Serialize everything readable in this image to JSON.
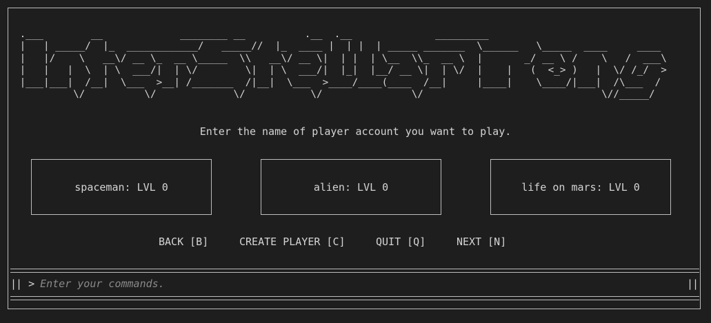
{
  "banner": {
    "ascii_art": " .___        __             ________ __          .__  .__              _________            \n |   | _____/  |_  ____________/   _____//  |_  ____ |  | |  | _____ _______  \\______   \\_____  ____     ____ \n |   |/    \\   __\\/ __ \\_  __ \\_____  \\\\   __\\/ __ \\|  | |  | \\__  \\\\_  __ \\  |       _/ __ \\ /    \\   /  ___\\\n |   |   |  \\  | \\  ___/|  | \\/        \\|  | \\  ___/|  |_|  |__/ __ \\|  | \\/  |    |   (  <_> )   |  \\/ /_/  >\n |___|___|  /__|  \\___  >__| /_______  /|__|  \\___  >____/____(____  /__|     |____|    \\____/|___|  /\\___  / \n          \\/          \\/             \\/           \\/               \\/                              \\//_____/  "
  },
  "prompt": "Enter the name of player account you want to play.",
  "accounts": [
    {
      "label": "spaceman: LVL 0"
    },
    {
      "label": "alien: LVL 0"
    },
    {
      "label": "life on mars: LVL 0"
    }
  ],
  "menu": {
    "back": "BACK [B]",
    "create": "CREATE PLAYER [C]",
    "quit": "QUIT [Q]",
    "next": "NEXT [N]"
  },
  "command": {
    "left_border": "||",
    "chevron": ">",
    "placeholder": "Enter your commands.",
    "right_border": "||"
  },
  "colors": {
    "background": "#1e1e1e",
    "text": "#d4d4d4",
    "border": "#bdbdbd",
    "placeholder": "#8a8a8a"
  }
}
